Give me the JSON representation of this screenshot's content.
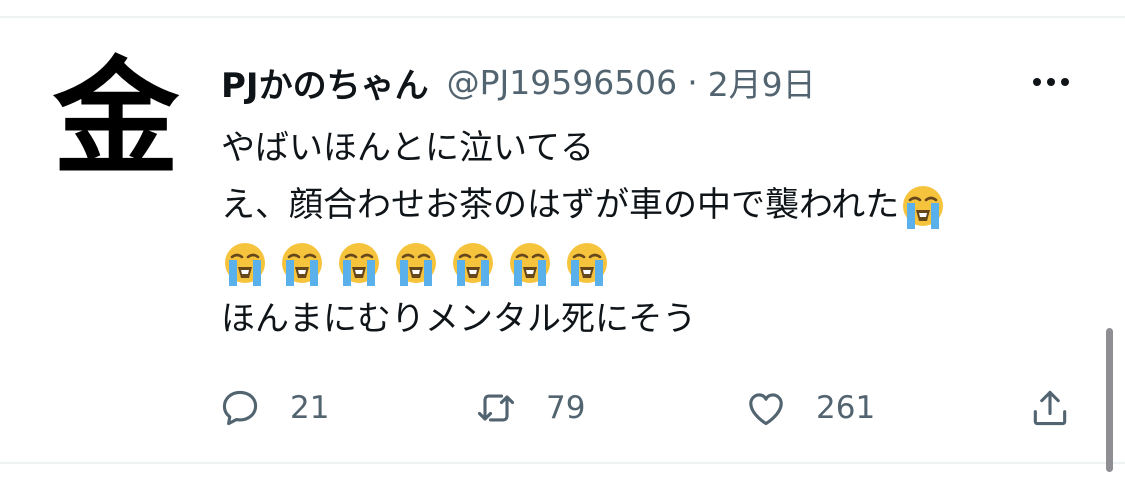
{
  "tweet": {
    "avatar_glyph": "金",
    "display_name": "PJかのちゃん",
    "handle": "@PJ19596506",
    "separator": "·",
    "date": "2月9日",
    "more_icon": "more-horizontal-icon",
    "text_lines": [
      "やばいほんとに泣いてる",
      "え、顔合わせお茶のはずが車の中で襲われた",
      "",
      "ほんまにむりメンタル死にそう"
    ],
    "emoji_name": "loudly-crying-face",
    "emoji_count_line2": 1,
    "emoji_count_line3": 7,
    "actions": {
      "reply_count": "21",
      "retweet_count": "79",
      "like_count": "261"
    }
  },
  "colors": {
    "text_primary": "#0f1419",
    "text_secondary": "#536471",
    "divider": "#eff3f4",
    "emoji_face": "#f6c33d",
    "emoji_tears": "#5ab0ea"
  }
}
